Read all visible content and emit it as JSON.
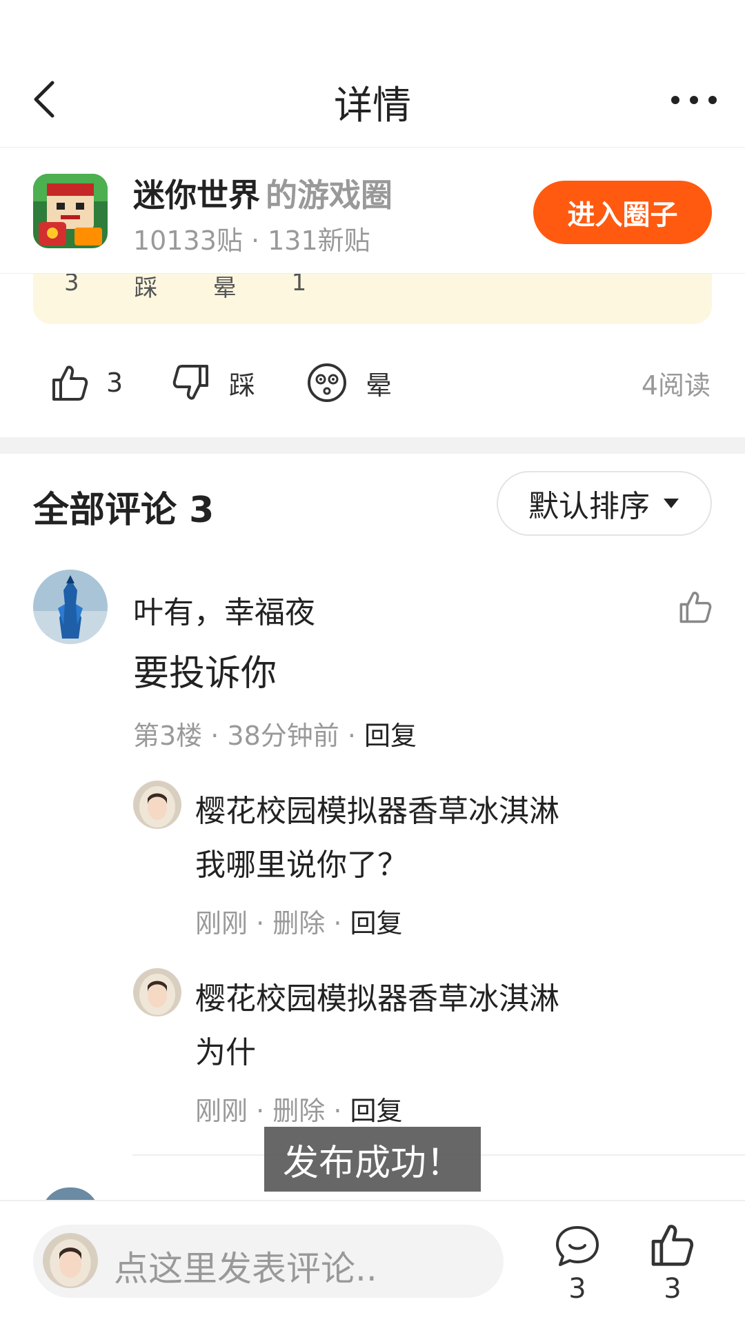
{
  "header": {
    "title": "详情"
  },
  "circle": {
    "name": "迷你世界",
    "suffix": "的游戏圈",
    "stats": "10133贴 · 131新贴",
    "enter_label": "进入圈子"
  },
  "quote_card": {
    "like_count": "3",
    "dislike_label": "踩",
    "dizzy_label": "晕",
    "comment_count": "1"
  },
  "reactions": {
    "like_count": "3",
    "dislike_label": "踩",
    "dizzy_label": "晕",
    "read_count": "4阅读"
  },
  "comments": {
    "title": "全部评论 3",
    "sort_label": "默认排序",
    "items": [
      {
        "author": "叶有，幸福夜",
        "text": "要投诉你",
        "meta_prefix": "第3楼 · 38分钟前 · ",
        "reply_label": "回复",
        "replies": [
          {
            "author": "樱花校园模拟器香草冰淇淋",
            "text": "我哪里说你了？",
            "meta_prefix": "刚刚 · 删除 · ",
            "reply_label": "回复"
          },
          {
            "author": "樱花校园模拟器香草冰淇淋",
            "text": "为什",
            "meta_prefix": "刚刚 · 删除 · ",
            "reply_label": "回复"
          }
        ]
      }
    ]
  },
  "toast": {
    "text": "发布成功！"
  },
  "bottom_bar": {
    "placeholder": "点这里发表评论..",
    "comment_count": "3",
    "like_count": "3"
  },
  "colors": {
    "accent": "#ff5a10",
    "muted": "#999999",
    "card_bg": "#fdf7e0"
  }
}
